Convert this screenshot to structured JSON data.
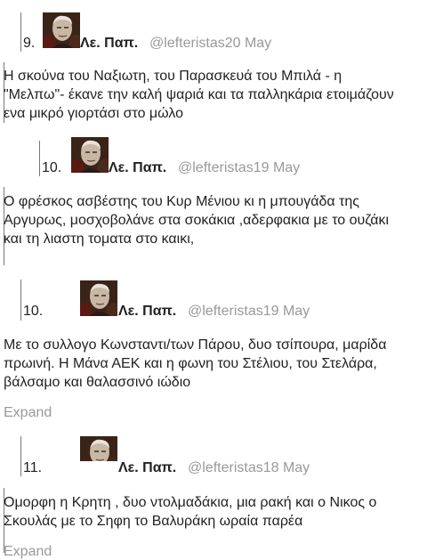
{
  "tweets": [
    {
      "number": "9.",
      "name": "Λε. Παπ.",
      "handle": "@lefteristas20 May",
      "lines": [
        "Η σκούνα του Ναξιωτη, του Παρασκευά του Μπιλά - η",
        "\"Μελπω\"- έκανε την καλή ψαριά και τα παλληκάρια ετοιμάζουν",
        "ενα μικρό γιορτάσι στο μώλο"
      ]
    },
    {
      "number": "10.",
      "name": "Λε. Παπ.",
      "handle": "@lefteristas19 May",
      "lines": [
        "Ο φρέσκος ασβέστης του Κυρ Μένιου κι η μπουγάδα της",
        "Αργυρως, μοσχοβολάνε στα σοκάκια ,αδερφακια με το ουζάκι",
        "και τη λιαστη τοματα στο καικι,"
      ]
    },
    {
      "number": "10.",
      "name": "Λε. Παπ.",
      "handle": "@lefteristas19 May",
      "lines": [
        "Με το συλλογο Κωνσταντι/των Πάρου, δυο τσίπουρα, μαρίδα",
        "πρωινή. Η Μάνα ΑΕΚ και η φωνη του Στέλιου, του Στελάρα,",
        "βάλσαμο και θαλασσινό ιώδιο"
      ],
      "expand": "Expand"
    },
    {
      "number": "11.",
      "name": "Λε. Παπ.",
      "handle": "@lefteristas18 May",
      "lines": [
        "Ομορφη η Κρητη , δυο ντολμαδάκια, μια ρακή και ο Νικος ο",
        "Σκουλάς με το Σηφη το Βαλυράκη ωραία παρέα"
      ],
      "expand": "Expand"
    }
  ]
}
